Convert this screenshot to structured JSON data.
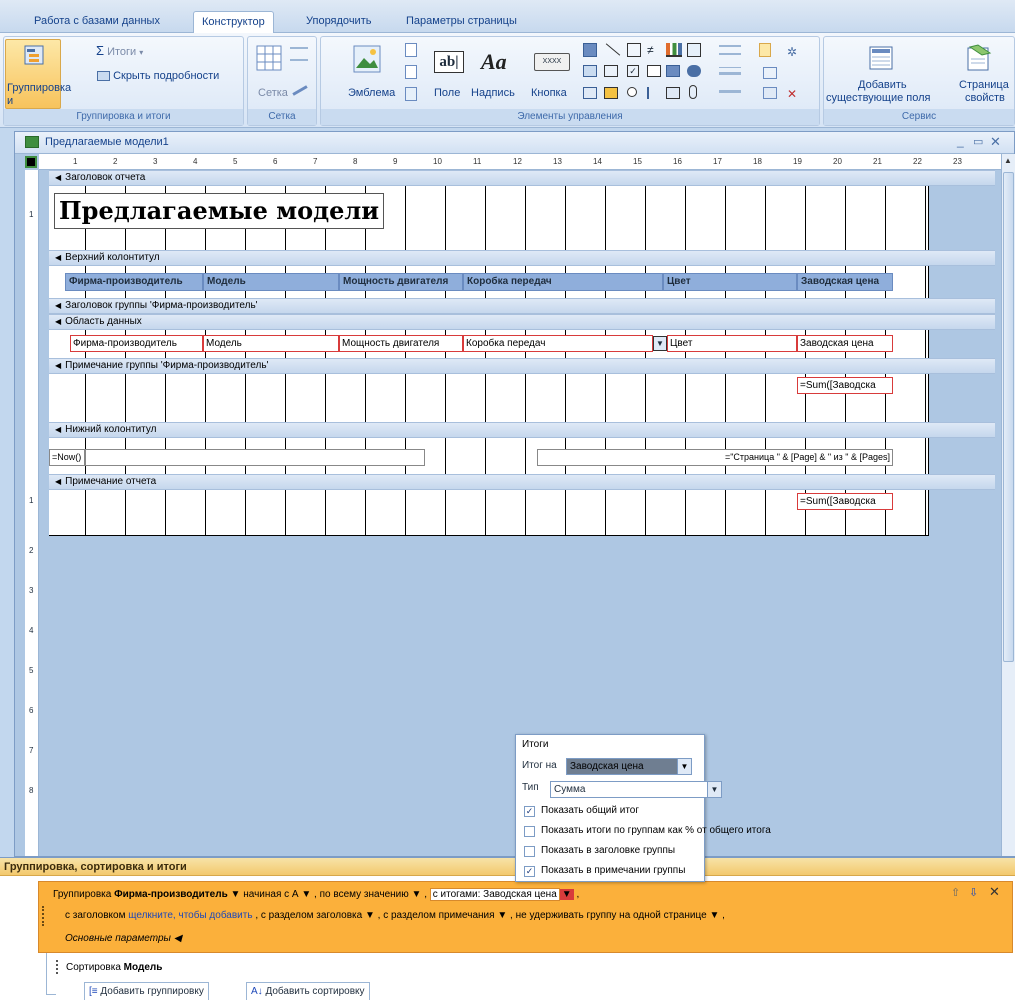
{
  "ribbon": {
    "tabs": [
      "Работа с базами данных",
      "Конструктор",
      "Упорядочить",
      "Параметры страницы"
    ],
    "active_tab": "Конструктор",
    "groups": {
      "grouping": {
        "label": "Группировка и итоги",
        "group_sort_l1": "Группировка",
        "group_sort_l2": "и сортировка",
        "totals": "Итоги",
        "hide_details": "Скрыть подробности"
      },
      "grid": {
        "label": "Сетка",
        "button": "Сетка"
      },
      "controls": {
        "label": "Элементы управления",
        "logo": "Эмблема",
        "field": "Поле",
        "caption": "Надпись",
        "button": "Кнопка",
        "text_sample": "XXXX"
      },
      "service": {
        "label": "Сервис",
        "add_fields_l1": "Добавить",
        "add_fields_l2": "существующие поля",
        "props_l1": "Страница",
        "props_l2": "свойств"
      }
    }
  },
  "document": {
    "title": "Предлагаемые модели1",
    "ruler_marks": [
      "1",
      "2",
      "3",
      "4",
      "5",
      "6",
      "7",
      "8",
      "9",
      "10",
      "11",
      "12",
      "13",
      "14",
      "15",
      "16",
      "17",
      "18",
      "19",
      "20",
      "21",
      "22",
      "23"
    ],
    "vruler_marks": [
      "1",
      "1",
      "2",
      "3",
      "4",
      "5",
      "6",
      "7",
      "8"
    ],
    "bands": {
      "report_header": "Заголовок отчета",
      "page_header": "Верхний колонтитул",
      "group_header": "Заголовок группы 'Фирма-производитель'",
      "detail": "Область данных",
      "group_footer": "Примечание группы 'Фирма-производитель'",
      "page_footer": "Нижний колонтитул",
      "report_footer": "Примечание отчета"
    },
    "report_title": "Предлагаемые модели",
    "headers": [
      "Фирма-производитель",
      "Модель",
      "Мощность двигателя",
      "Коробка передач",
      "Цвет",
      "Заводская цена"
    ],
    "detail_fields": [
      "Фирма-производитель",
      "Модель",
      "Мощность двигателя",
      "Коробка передач",
      "Цвет",
      "Заводская цена"
    ],
    "group_sum": "=Sum([Заводска",
    "footer_now": "=Now()",
    "footer_page": "=\"Страница \" & [Page] & \" из \" & [Pages]",
    "report_sum": "=Sum([Заводска"
  },
  "totals_popup": {
    "title": "Итоги",
    "total_on_label": "Итог на",
    "total_on_value": "Заводская цена",
    "type_label": "Тип",
    "type_value": "Сумма",
    "options": [
      {
        "label": "Показать общий итог",
        "checked": true
      },
      {
        "label": "Показать итоги по группам как % от общего итога",
        "checked": false
      },
      {
        "label": "Показать в заголовке группы",
        "checked": false
      },
      {
        "label": "Показать в примечании группы",
        "checked": true
      }
    ]
  },
  "gsp": {
    "title": "Группировка, сортировка и итоги",
    "group_prefix": "Группировка",
    "group_field": "Фирма-производитель",
    "from_a": "начиная с А",
    "whole_value": "по всему значению",
    "with_totals": "с итогами: Заводская цена",
    "with_header": "с заголовком",
    "click_to_add": "щелкните, чтобы добавить",
    "with_header_section": "с разделом заголовка",
    "with_footer_section": "с разделом примечания",
    "keep_together": "не удерживать группу на одной странице",
    "basic_params": "Основные параметры",
    "sort_prefix": "Сортировка",
    "sort_field": "Модель",
    "add_group": "Добавить группировку",
    "add_sort": "Добавить сортировку"
  }
}
